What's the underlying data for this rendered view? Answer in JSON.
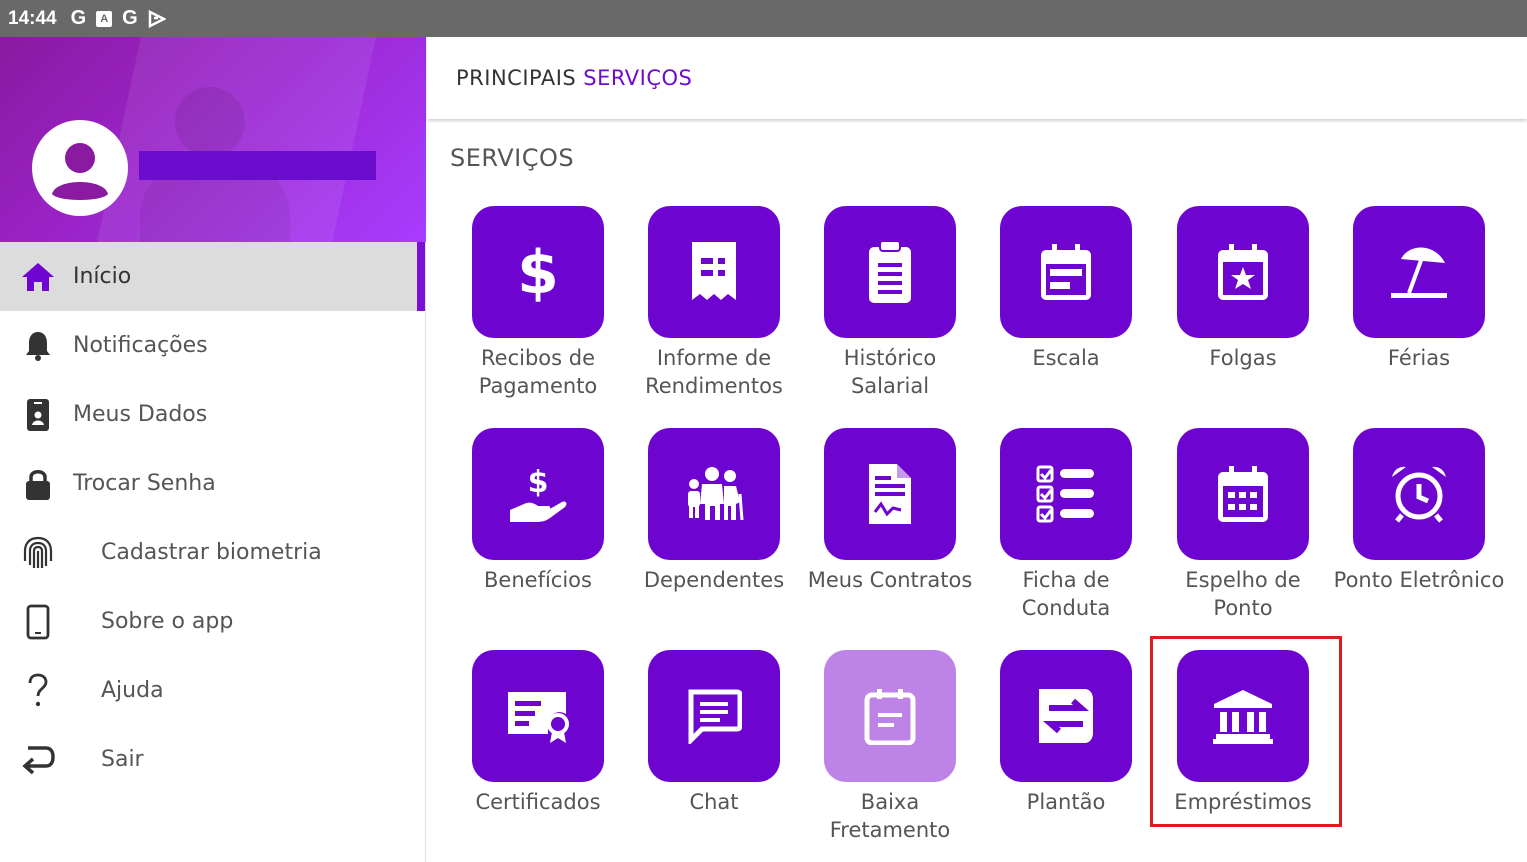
{
  "status_bar": {
    "time": "14:44",
    "icons": [
      "G",
      "A",
      "G",
      "play-icon"
    ]
  },
  "sidebar": {
    "profile_name": "",
    "items": [
      {
        "label": "Início",
        "icon": "home-icon",
        "active": true
      },
      {
        "label": "Notificações",
        "icon": "bell-icon"
      },
      {
        "label": "Meus Dados",
        "icon": "id-badge-icon"
      },
      {
        "label": "Trocar Senha",
        "icon": "lock-icon"
      },
      {
        "label": "Cadastrar biometria",
        "icon": "fingerprint-icon"
      },
      {
        "label": "Sobre o app",
        "icon": "phone-icon"
      },
      {
        "label": "Ajuda",
        "icon": "question-icon"
      },
      {
        "label": "Sair",
        "icon": "exit-arrow-icon"
      }
    ]
  },
  "header": {
    "title": "PRINCIPAIS",
    "title_accent": "SERVIÇOS"
  },
  "section": {
    "title": "SERVIÇOS"
  },
  "services": [
    {
      "label": "Recibos de Pagamento",
      "icon": "dollar-icon"
    },
    {
      "label": "Informe de Rendimentos",
      "icon": "receipt-icon"
    },
    {
      "label": "Histórico Salarial",
      "icon": "clipboard-icon"
    },
    {
      "label": "Escala",
      "icon": "calendar-schedule-icon"
    },
    {
      "label": "Folgas",
      "icon": "calendar-star-icon"
    },
    {
      "label": "Férias",
      "icon": "beach-umbrella-icon"
    },
    {
      "label": "Benefícios",
      "icon": "hand-dollar-icon"
    },
    {
      "label": "Dependentes",
      "icon": "family-icon"
    },
    {
      "label": "Meus Contratos",
      "icon": "contract-icon"
    },
    {
      "label": "Ficha de Conduta",
      "icon": "checklist-icon"
    },
    {
      "label": "Espelho de Ponto",
      "icon": "calendar-grid-icon"
    },
    {
      "label": "Ponto Eletrônico",
      "icon": "alarm-clock-icon"
    },
    {
      "label": "Certificados",
      "icon": "certificate-icon"
    },
    {
      "label": "Chat",
      "icon": "chat-icon"
    },
    {
      "label": "Baixa Fretamento",
      "icon": "calendar-doc-icon",
      "disabled": true
    },
    {
      "label": "Plantão",
      "icon": "swap-arrows-icon"
    },
    {
      "label": "Empréstimos",
      "icon": "bank-icon",
      "highlighted": true
    }
  ],
  "colors": {
    "accent": "#6e04cf",
    "disabled_tile": "#be83e6",
    "highlight_border": "#d91e1e"
  }
}
